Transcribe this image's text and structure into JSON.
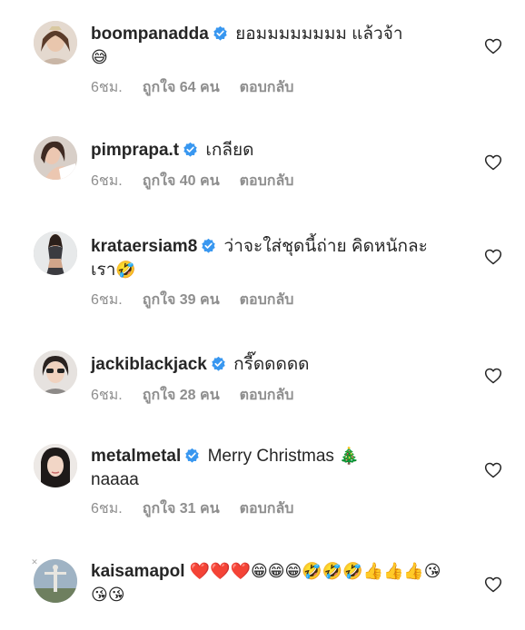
{
  "comments": [
    {
      "username": "boompanadda",
      "text": "ยอมมมมมมมม แล้วจ้า",
      "emoji": "😅",
      "time": "6ชม.",
      "likes": "ถูกใจ 64 คน",
      "reply": "ตอบกลับ"
    },
    {
      "username": "pimprapa.t",
      "text": "เกลียด",
      "emoji": "",
      "time": "6ชม.",
      "likes": "ถูกใจ 40 คน",
      "reply": "ตอบกลับ"
    },
    {
      "username": "krataersiam8",
      "text": "ว่าจะใส่ชุดนี้ถ่าย คิดหนักละเรา",
      "emoji": "🤣",
      "time": "6ชม.",
      "likes": "ถูกใจ 39 คน",
      "reply": "ตอบกลับ"
    },
    {
      "username": "jackiblackjack",
      "text": "กรี๊ดดดดด",
      "emoji": "",
      "time": "6ชม.",
      "likes": "ถูกใจ 28 คน",
      "reply": "ตอบกลับ"
    },
    {
      "username": "metalmetal",
      "text": "Merry Christmas",
      "emoji": "🎄",
      "text2": "naaaa",
      "time": "6ชม.",
      "likes": "ถูกใจ 31 คน",
      "reply": "ตอบกลับ"
    },
    {
      "username": "kaisamapol",
      "text": "",
      "emoji": "❤️❤️❤️😁😁😁🤣🤣🤣👍👍👍😘😘😘"
    }
  ],
  "colors": {
    "text": "#262626",
    "meta": "#8e8e8e",
    "verified": "#3897f0",
    "heart_outline": "#262626"
  },
  "icons": {
    "verified": "verified-badge-icon",
    "like": "heart-outline-icon",
    "close": "close-icon"
  }
}
